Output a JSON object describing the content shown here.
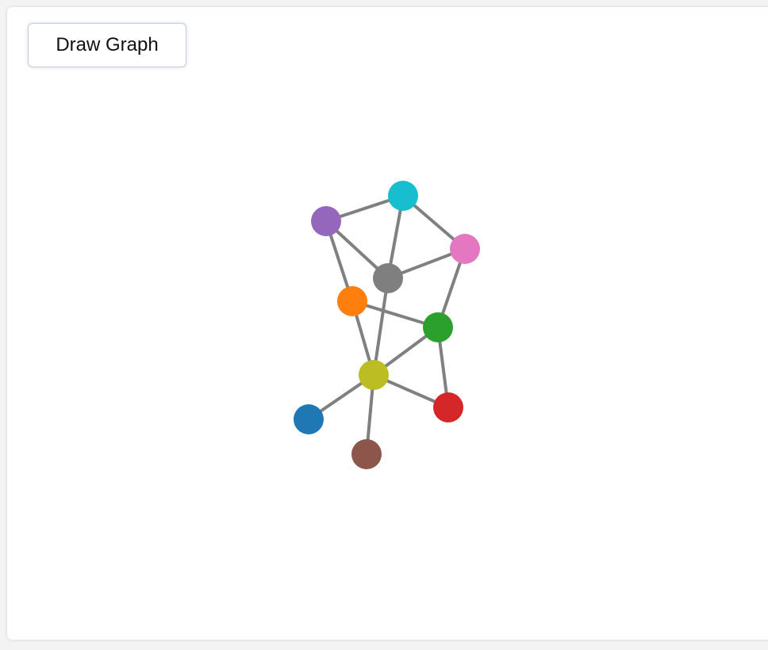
{
  "toolbar": {
    "draw_label": "Draw Graph"
  },
  "graph": {
    "edge_color": "#808080",
    "nodes": [
      {
        "id": "cyan",
        "color": "#17becf"
      },
      {
        "id": "purple",
        "color": "#9467bd"
      },
      {
        "id": "pink",
        "color": "#e377c2"
      },
      {
        "id": "gray",
        "color": "#7f7f7f"
      },
      {
        "id": "orange",
        "color": "#ff7f0e"
      },
      {
        "id": "green",
        "color": "#2ca02c"
      },
      {
        "id": "olive",
        "color": "#bcbd22"
      },
      {
        "id": "red",
        "color": "#d62728"
      },
      {
        "id": "blue",
        "color": "#1f77b4"
      },
      {
        "id": "brown",
        "color": "#8c564b"
      }
    ],
    "edges": [
      [
        "purple",
        "cyan"
      ],
      [
        "cyan",
        "pink"
      ],
      [
        "cyan",
        "gray"
      ],
      [
        "purple",
        "gray"
      ],
      [
        "purple",
        "orange"
      ],
      [
        "gray",
        "pink"
      ],
      [
        "pink",
        "green"
      ],
      [
        "gray",
        "olive"
      ],
      [
        "orange",
        "green"
      ],
      [
        "orange",
        "olive"
      ],
      [
        "green",
        "olive"
      ],
      [
        "green",
        "red"
      ],
      [
        "olive",
        "red"
      ],
      [
        "olive",
        "blue"
      ],
      [
        "olive",
        "brown"
      ]
    ]
  }
}
